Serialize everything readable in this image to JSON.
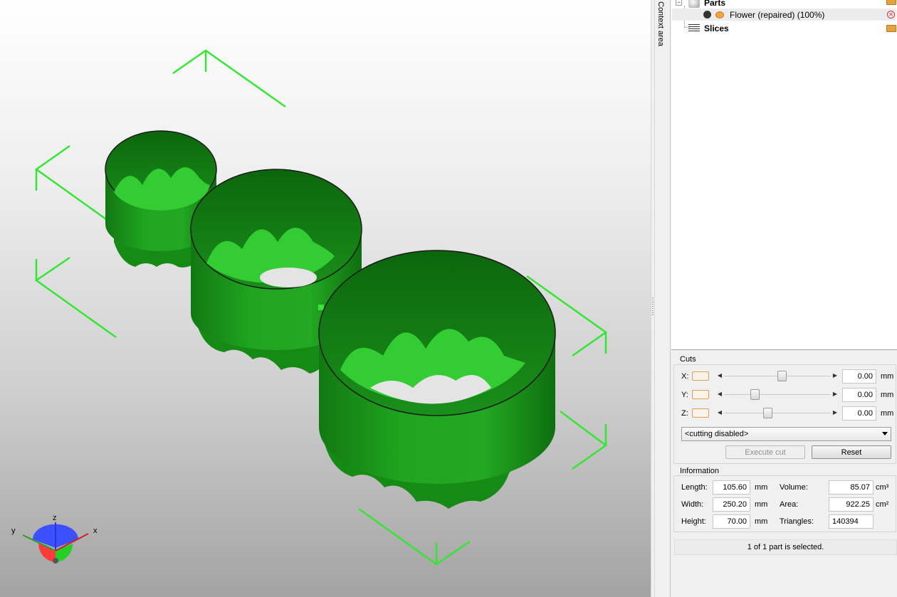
{
  "viewport": {
    "axes": {
      "x": "x",
      "y": "y",
      "z": "z"
    }
  },
  "context_tab": {
    "label": "Context area"
  },
  "tree": {
    "parts_label": "Parts",
    "part_name": "Flower (repaired) (100%)",
    "slices_label": "Slices"
  },
  "cuts": {
    "title": "Cuts",
    "rows": [
      {
        "axis": "X:",
        "value": "0.00",
        "unit": "mm",
        "slider_pos": 0.55
      },
      {
        "axis": "Y:",
        "value": "0.00",
        "unit": "mm",
        "slider_pos": 0.27
      },
      {
        "axis": "Z:",
        "value": "0.00",
        "unit": "mm",
        "slider_pos": 0.4
      }
    ],
    "mode_selected": "<cutting disabled>",
    "execute_label": "Execute cut",
    "reset_label": "Reset"
  },
  "information": {
    "title": "Information",
    "length_label": "Length:",
    "length_value": "105.60",
    "length_unit": "mm",
    "width_label": "Width:",
    "width_value": "250.20",
    "width_unit": "mm",
    "height_label": "Height:",
    "height_value": "70.00",
    "height_unit": "mm",
    "volume_label": "Volume:",
    "volume_value": "85.07",
    "volume_unit": "cm³",
    "area_label": "Area:",
    "area_value": "922.25",
    "area_unit": "cm²",
    "triangles_label": "Triangles:",
    "triangles_value": "140394"
  },
  "status": {
    "selection_text": "1 of 1 part is selected."
  },
  "colors": {
    "model_green": "#1fa51f",
    "bbox_green": "#33e633",
    "accent_orange": "#e0a050"
  }
}
